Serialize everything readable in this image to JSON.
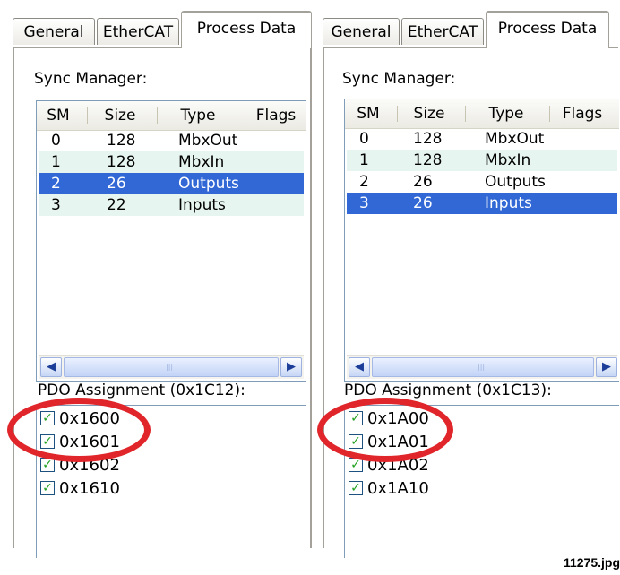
{
  "left_panel": {
    "tabs": [
      "General",
      "EtherCAT",
      "Process Data"
    ],
    "active_tab": "Process Data",
    "sync_manager_label": "Sync Manager:",
    "columns": [
      "SM",
      "Size",
      "Type",
      "Flags"
    ],
    "rows": [
      {
        "sm": "0",
        "size": "128",
        "type": "MbxOut",
        "flags": ""
      },
      {
        "sm": "1",
        "size": "128",
        "type": "MbxIn",
        "flags": ""
      },
      {
        "sm": "2",
        "size": "26",
        "type": "Outputs",
        "flags": ""
      },
      {
        "sm": "3",
        "size": "22",
        "type": "Inputs",
        "flags": ""
      }
    ],
    "selected_row": 2,
    "pdo_label": "PDO Assignment (0x1C12):",
    "pdo_items": [
      {
        "label": "0x1600",
        "checked": true
      },
      {
        "label": "0x1601",
        "checked": true
      },
      {
        "label": "0x1602",
        "checked": true
      },
      {
        "label": "0x1610",
        "checked": true
      }
    ]
  },
  "right_panel": {
    "tabs": [
      "General",
      "EtherCAT",
      "Process Data"
    ],
    "active_tab": "Process Data",
    "sync_manager_label": "Sync Manager:",
    "columns": [
      "SM",
      "Size",
      "Type",
      "Flags"
    ],
    "rows": [
      {
        "sm": "0",
        "size": "128",
        "type": "MbxOut",
        "flags": ""
      },
      {
        "sm": "1",
        "size": "128",
        "type": "MbxIn",
        "flags": ""
      },
      {
        "sm": "2",
        "size": "26",
        "type": "Outputs",
        "flags": ""
      },
      {
        "sm": "3",
        "size": "26",
        "type": "Inputs",
        "flags": ""
      }
    ],
    "selected_row": 3,
    "pdo_label": "PDO Assignment (0x1C13):",
    "pdo_items": [
      {
        "label": "0x1A00",
        "checked": true
      },
      {
        "label": "0x1A01",
        "checked": true
      },
      {
        "label": "0x1A02",
        "checked": true
      },
      {
        "label": "0x1A10",
        "checked": true
      }
    ]
  },
  "caption": "11275.jpg",
  "colors": {
    "selection": "#3168d5",
    "alt_row": "#e6f5ef",
    "highlight_oval": "#e0262b",
    "active_tab_accent": "#f2a93c"
  },
  "icons": {
    "scroll_left": "arrow-left-icon",
    "scroll_right": "arrow-right-icon",
    "checkbox": "checkmark-icon"
  }
}
